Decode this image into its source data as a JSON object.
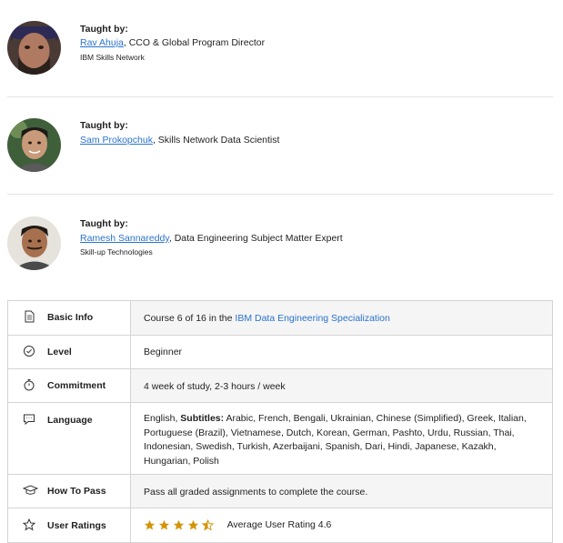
{
  "instructors": [
    {
      "taught_by": "Taught by:",
      "name": "Rav Ahuja",
      "title": ", CCO & Global Program Director",
      "org": "IBM Skills Network"
    },
    {
      "taught_by": "Taught by:",
      "name": "Sam Prokopchuk",
      "title": ", Skills Network Data Scientist",
      "org": ""
    },
    {
      "taught_by": "Taught by:",
      "name": "Ramesh Sannareddy",
      "title": ", Data Engineering Subject Matter Expert",
      "org": "Skill-up Technologies"
    }
  ],
  "info": {
    "basic": {
      "label": "Basic Info",
      "prefix": "Course 6 of 16 in the ",
      "link": "IBM Data Engineering Specialization"
    },
    "level": {
      "label": "Level",
      "value": "Beginner"
    },
    "commitment": {
      "label": "Commitment",
      "value": "4 week of study, 2-3 hours / week"
    },
    "language": {
      "label": "Language",
      "lead": "English, ",
      "subtitles_label": "Subtitles:",
      "subtitles": " Arabic, French, Bengali, Ukrainian, Chinese (Simplified), Greek, Italian, Portuguese (Brazil), Vietnamese, Dutch, Korean, German, Pashto, Urdu, Russian, Thai, Indonesian, Swedish, Turkish, Azerbaijani, Spanish, Dari, Hindi, Japanese, Kazakh, Hungarian, Polish"
    },
    "how_to_pass": {
      "label": "How To Pass",
      "value": "Pass all graded assignments to complete the course."
    },
    "ratings": {
      "label": "User Ratings",
      "value": "Average User Rating 4.6",
      "rating": 4.6
    }
  },
  "colors": {
    "link": "#2a73cc",
    "star": "#d4940a",
    "border": "#d4d4d4",
    "shaded": "#f5f5f5"
  },
  "icons": [
    "document-icon",
    "check-circle-icon",
    "stopwatch-icon",
    "chat-bubble-icon",
    "graduation-cap-icon",
    "star-outline-icon"
  ]
}
